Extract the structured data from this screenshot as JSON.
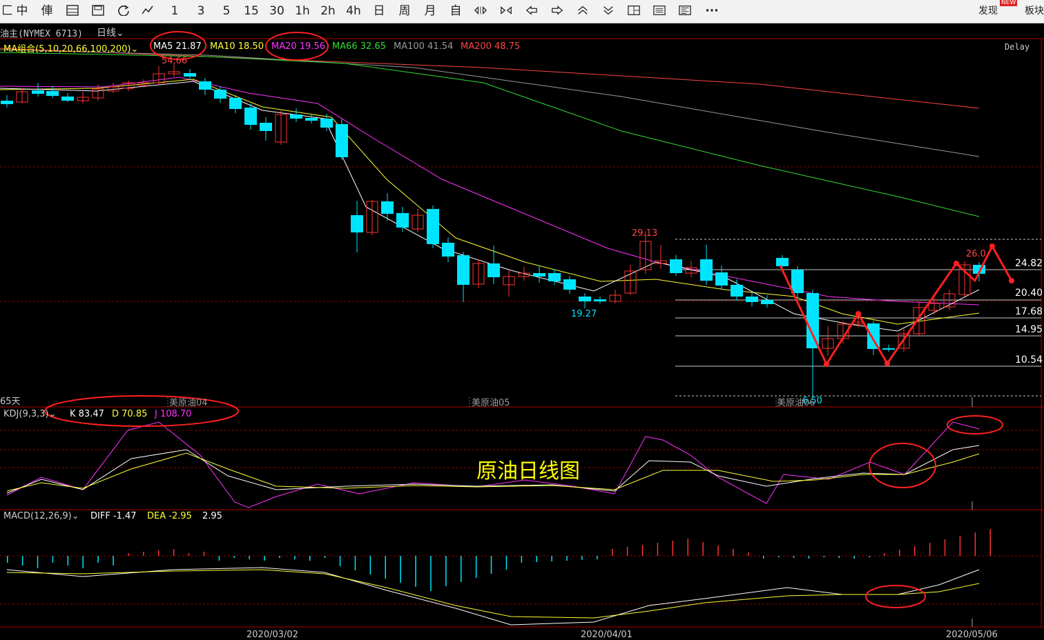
{
  "toolbar": {
    "tools": [
      "中",
      "俥"
    ],
    "periods": [
      "1",
      "3",
      "5",
      "15",
      "30",
      "1h",
      "2h",
      "4h",
      "日",
      "周",
      "月",
      "自"
    ],
    "more": "···",
    "discover": "发现",
    "discover_badge": "NEW",
    "board": "板块"
  },
  "header": {
    "instrument": "油主(NYMEX 6713)",
    "period": "日线"
  },
  "ma_legend": {
    "group": "MA组合(5,10,20,66,100,200)",
    "items": [
      {
        "label": "MA5 21.87",
        "color": "#ffffff"
      },
      {
        "label": "MA10 18.50",
        "color": "#ffff33"
      },
      {
        "label": "MA20 19.56",
        "color": "#ff33ff"
      },
      {
        "label": "MA66 32.65",
        "color": "#33dd33"
      },
      {
        "label": "MA100 41.54",
        "color": "#999999"
      },
      {
        "label": "MA200 48.75",
        "color": "#ff4444"
      }
    ],
    "delay": "Delay"
  },
  "price_labels": {
    "high1": "54.66",
    "high2": "29.13",
    "low1": "19.27",
    "low2": "6.50",
    "high3": "26.0"
  },
  "levels": [
    "24.82",
    "20.40",
    "17.68",
    "14.95",
    "10.54"
  ],
  "contracts": {
    "days": "65天",
    "c1": "美原油04",
    "c2": "美原油05",
    "c3": "美原油06"
  },
  "kdj": {
    "name": "KDJ(9,3,3)",
    "k": "K 83.47",
    "d": "D 70.85",
    "j": "J 108.70"
  },
  "caption": "原油日线图",
  "macd": {
    "name": "MACD(12,26,9)",
    "diff": "DIFF -1.47",
    "dea": "DEA -2.95",
    "macd": "2.95"
  },
  "dates": [
    "2020/03/02",
    "2020/04/01",
    "2020/05/06"
  ],
  "colors": {
    "up": "#ff3333",
    "down": "#00e5ff",
    "annotation": "#ff2020",
    "grid": "#8b0000",
    "caption": "#ffff00"
  }
}
